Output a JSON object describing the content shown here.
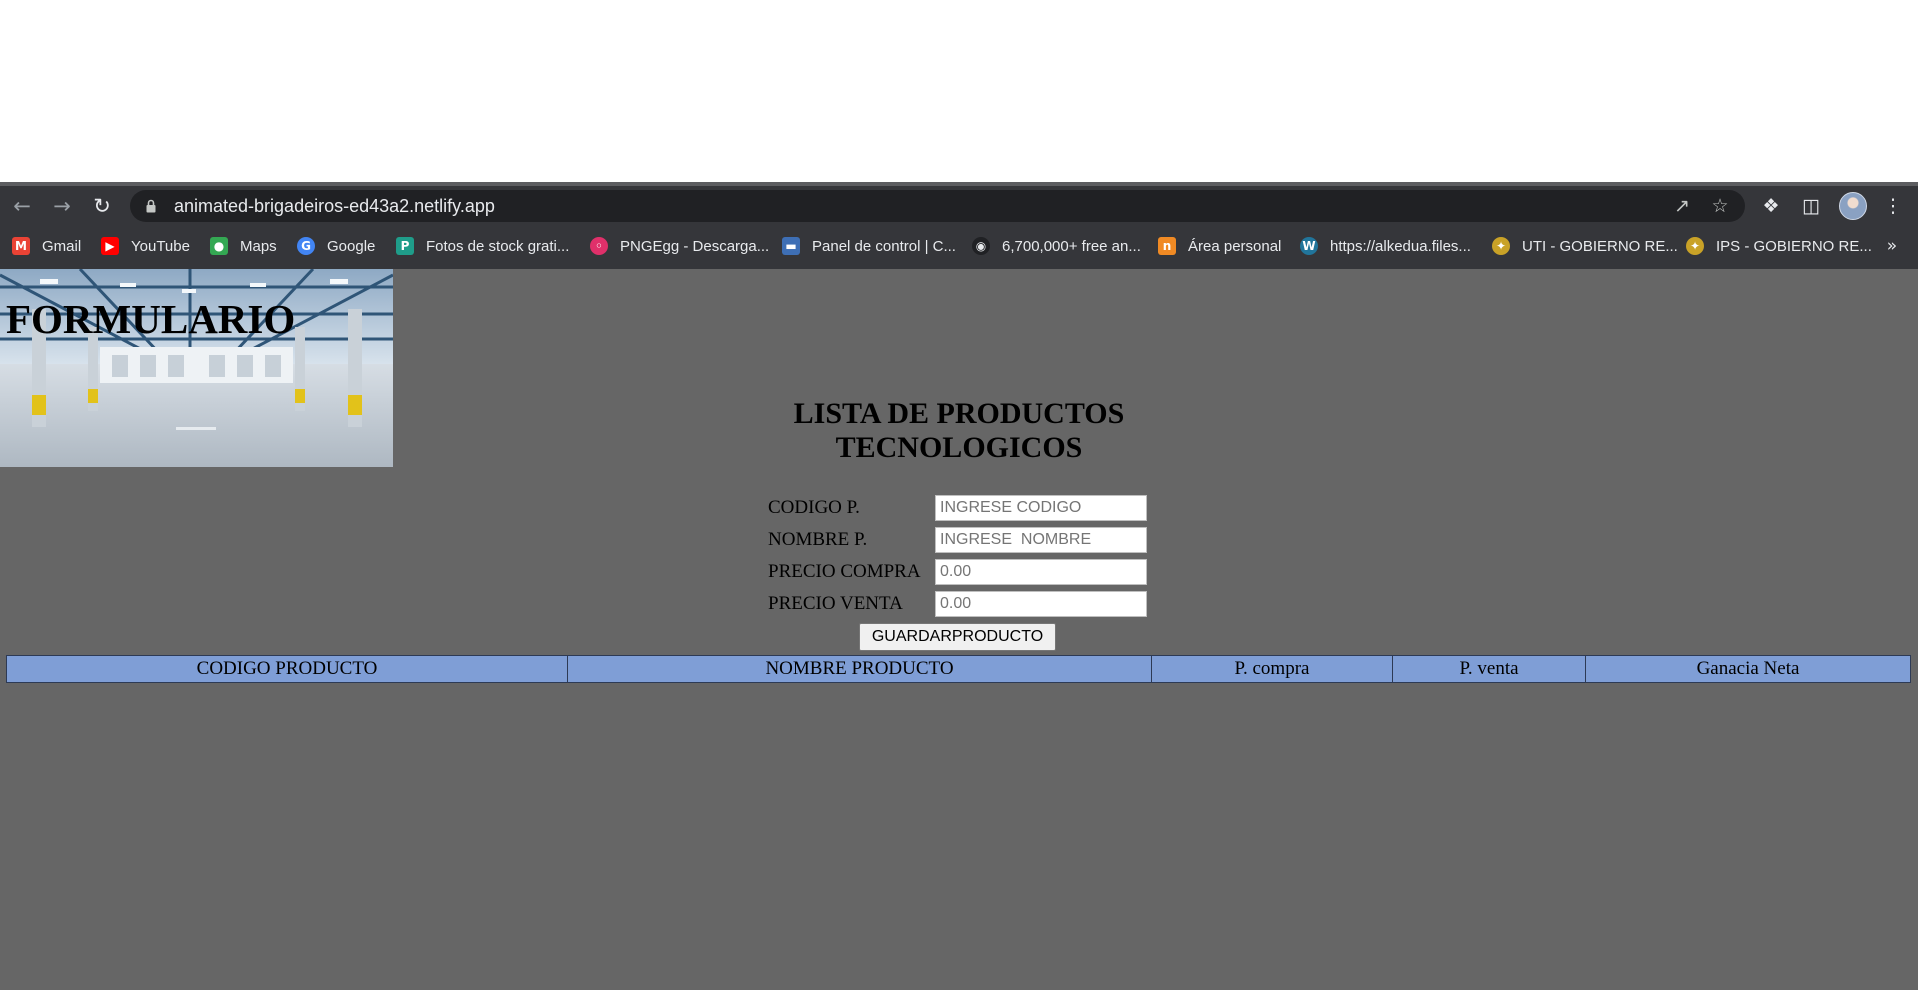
{
  "browser": {
    "url": "animated-brigadeiros-ed43a2.netlify.app",
    "icons": [
      "back-arrow-icon",
      "forward-arrow-icon",
      "reload-icon",
      "lock-icon",
      "share-icon",
      "star-icon",
      "extensions-icon",
      "side-panel-icon",
      "profile-avatar",
      "kebab-menu-icon",
      "chevron-double-right-icon"
    ]
  },
  "bookmarks": [
    {
      "label": "Gmail",
      "icon": "gmail-icon",
      "color": "#ea4335"
    },
    {
      "label": "YouTube",
      "icon": "youtube-icon",
      "color": "#ff0000"
    },
    {
      "label": "Maps",
      "icon": "maps-icon",
      "color": "#34a853"
    },
    {
      "label": "Google",
      "icon": "google-icon",
      "color": "#4285f4"
    },
    {
      "label": "Fotos de stock grati...",
      "icon": "stock-photos-icon",
      "color": "#1f9d8a"
    },
    {
      "label": "PNGEgg - Descarga...",
      "icon": "pngegg-icon",
      "color": "#e0306a"
    },
    {
      "label": "Panel de control | C...",
      "icon": "control-panel-icon",
      "color": "#3e6fb5"
    },
    {
      "label": "6,700,000+ free an...",
      "icon": "free-animations-icon",
      "color": "#202124"
    },
    {
      "label": "Área personal",
      "icon": "personal-area-icon",
      "color": "#f08a24"
    },
    {
      "label": "https://alkedua.files...",
      "icon": "wordpress-icon",
      "color": "#21759b"
    },
    {
      "label": "UTI - GOBIERNO RE...",
      "icon": "government-seal-icon",
      "color": "#c9a227"
    },
    {
      "label": "IPS - GOBIERNO RE...",
      "icon": "government-seal-icon",
      "color": "#c9a227"
    }
  ],
  "page": {
    "banner_title": "FORMULARIO",
    "heading_line1": "LISTA DE PRODUCTOS",
    "heading_line2": "TECNOLOGICOS",
    "form": {
      "fields": [
        {
          "label": "CODIGO P.",
          "placeholder": "INGRESE CODIGO",
          "value": ""
        },
        {
          "label": "NOMBRE P.",
          "placeholder": "INGRESE  NOMBRE",
          "value": ""
        },
        {
          "label": "PRECIO COMPRA",
          "placeholder": "0.00",
          "value": ""
        },
        {
          "label": "PRECIO VENTA",
          "placeholder": "0.00",
          "value": ""
        }
      ],
      "submit_label": "GUARDARPRODUCTO"
    },
    "table": {
      "headers": [
        "CODIGO PRODUCTO",
        "NOMBRE PRODUCTO",
        "P. compra",
        "P. venta",
        "Ganacia Neta"
      ],
      "rows": []
    },
    "colors": {
      "background": "#666666",
      "table_header": "#7f9ed6"
    }
  }
}
